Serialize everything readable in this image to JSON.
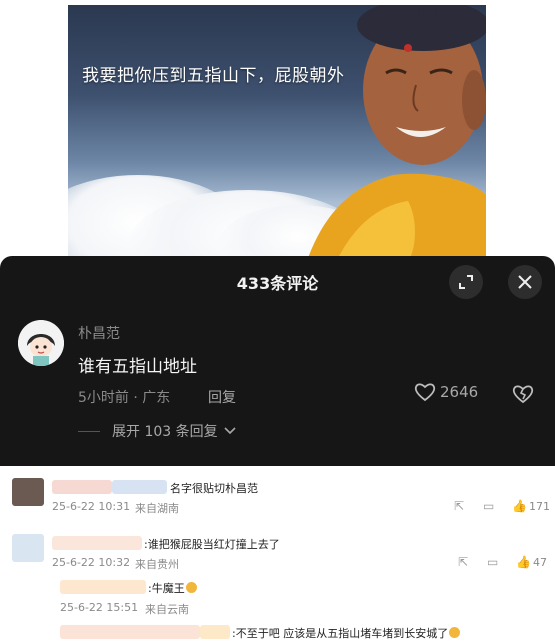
{
  "image": {
    "caption": "我要把你压到五指山下，屁股朝外"
  },
  "panel": {
    "title": "433条评论",
    "expand_icon": "expand-icon",
    "close_icon": "close-icon"
  },
  "comment": {
    "username": "朴昌范",
    "text": "谁有五指山地址",
    "meta": "5小时前 · 广东",
    "reply_label": "回复",
    "likes": "2646",
    "expand_replies": "展开 103 条回复"
  },
  "replies": [
    {
      "text": "名字很贴切朴昌范",
      "date": "25-6-22 10:31",
      "location": "来自湖南",
      "likes": "171"
    },
    {
      "text": ":谁把猴屁股当红灯撞上去了",
      "date": "25-6-22 10:32",
      "location": "来自贵州",
      "likes": "47"
    },
    {
      "text": ":牛魔王",
      "date": "25-6-22 15:51",
      "location": "来自云南"
    },
    {
      "text": ":不至于吧  应该是从五指山堵车堵到长安城了"
    }
  ]
}
